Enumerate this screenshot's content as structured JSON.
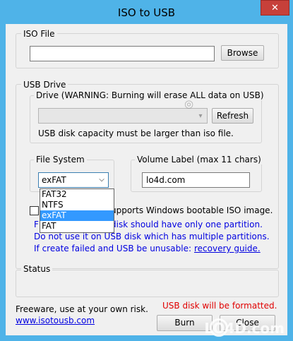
{
  "window": {
    "title": "ISO to USB",
    "close_glyph": "✕"
  },
  "iso_file": {
    "group_label": "ISO File",
    "path_value": "",
    "browse_label": "Browse"
  },
  "usb_drive": {
    "group_label": "USB Drive",
    "drive_label": "Drive (WARNING: Burning will erase ALL data on USB)",
    "drive_value": "",
    "refresh_label": "Refresh",
    "capacity_note": "USB disk capacity must be larger than iso file."
  },
  "file_system": {
    "group_label": "File System",
    "selected": "exFAT",
    "options": [
      "FAT32",
      "NTFS",
      "exFAT",
      "FAT"
    ]
  },
  "volume_label": {
    "group_label": "Volume Label (max 11 chars)",
    "value": "lo4d.com"
  },
  "bootable": {
    "label": "upports Windows bootable ISO image.",
    "checked": false
  },
  "notes": {
    "line1": "disk should have only one partition.",
    "line1_prefix": "F",
    "line2": "Do not use it on USB disk which has multiple partitions.",
    "line3_prefix": "If create failed and USB be unusable:",
    "line3_link": "recovery guide."
  },
  "status": {
    "group_label": "Status",
    "value": ""
  },
  "footer": {
    "freeware_note": "Freeware, use at your own risk.",
    "site_link": "www.isotousb.com",
    "format_warning": "USB disk will be formatted.",
    "burn_label": "Burn",
    "close_label": "Close"
  },
  "watermark": {
    "text": "LO4D.com"
  },
  "colors": {
    "titlebar": "#4fb3e8",
    "close_button": "#c7403a",
    "note_blue": "#0000e0",
    "warning_red": "#e00000",
    "selection": "#3399ff"
  }
}
